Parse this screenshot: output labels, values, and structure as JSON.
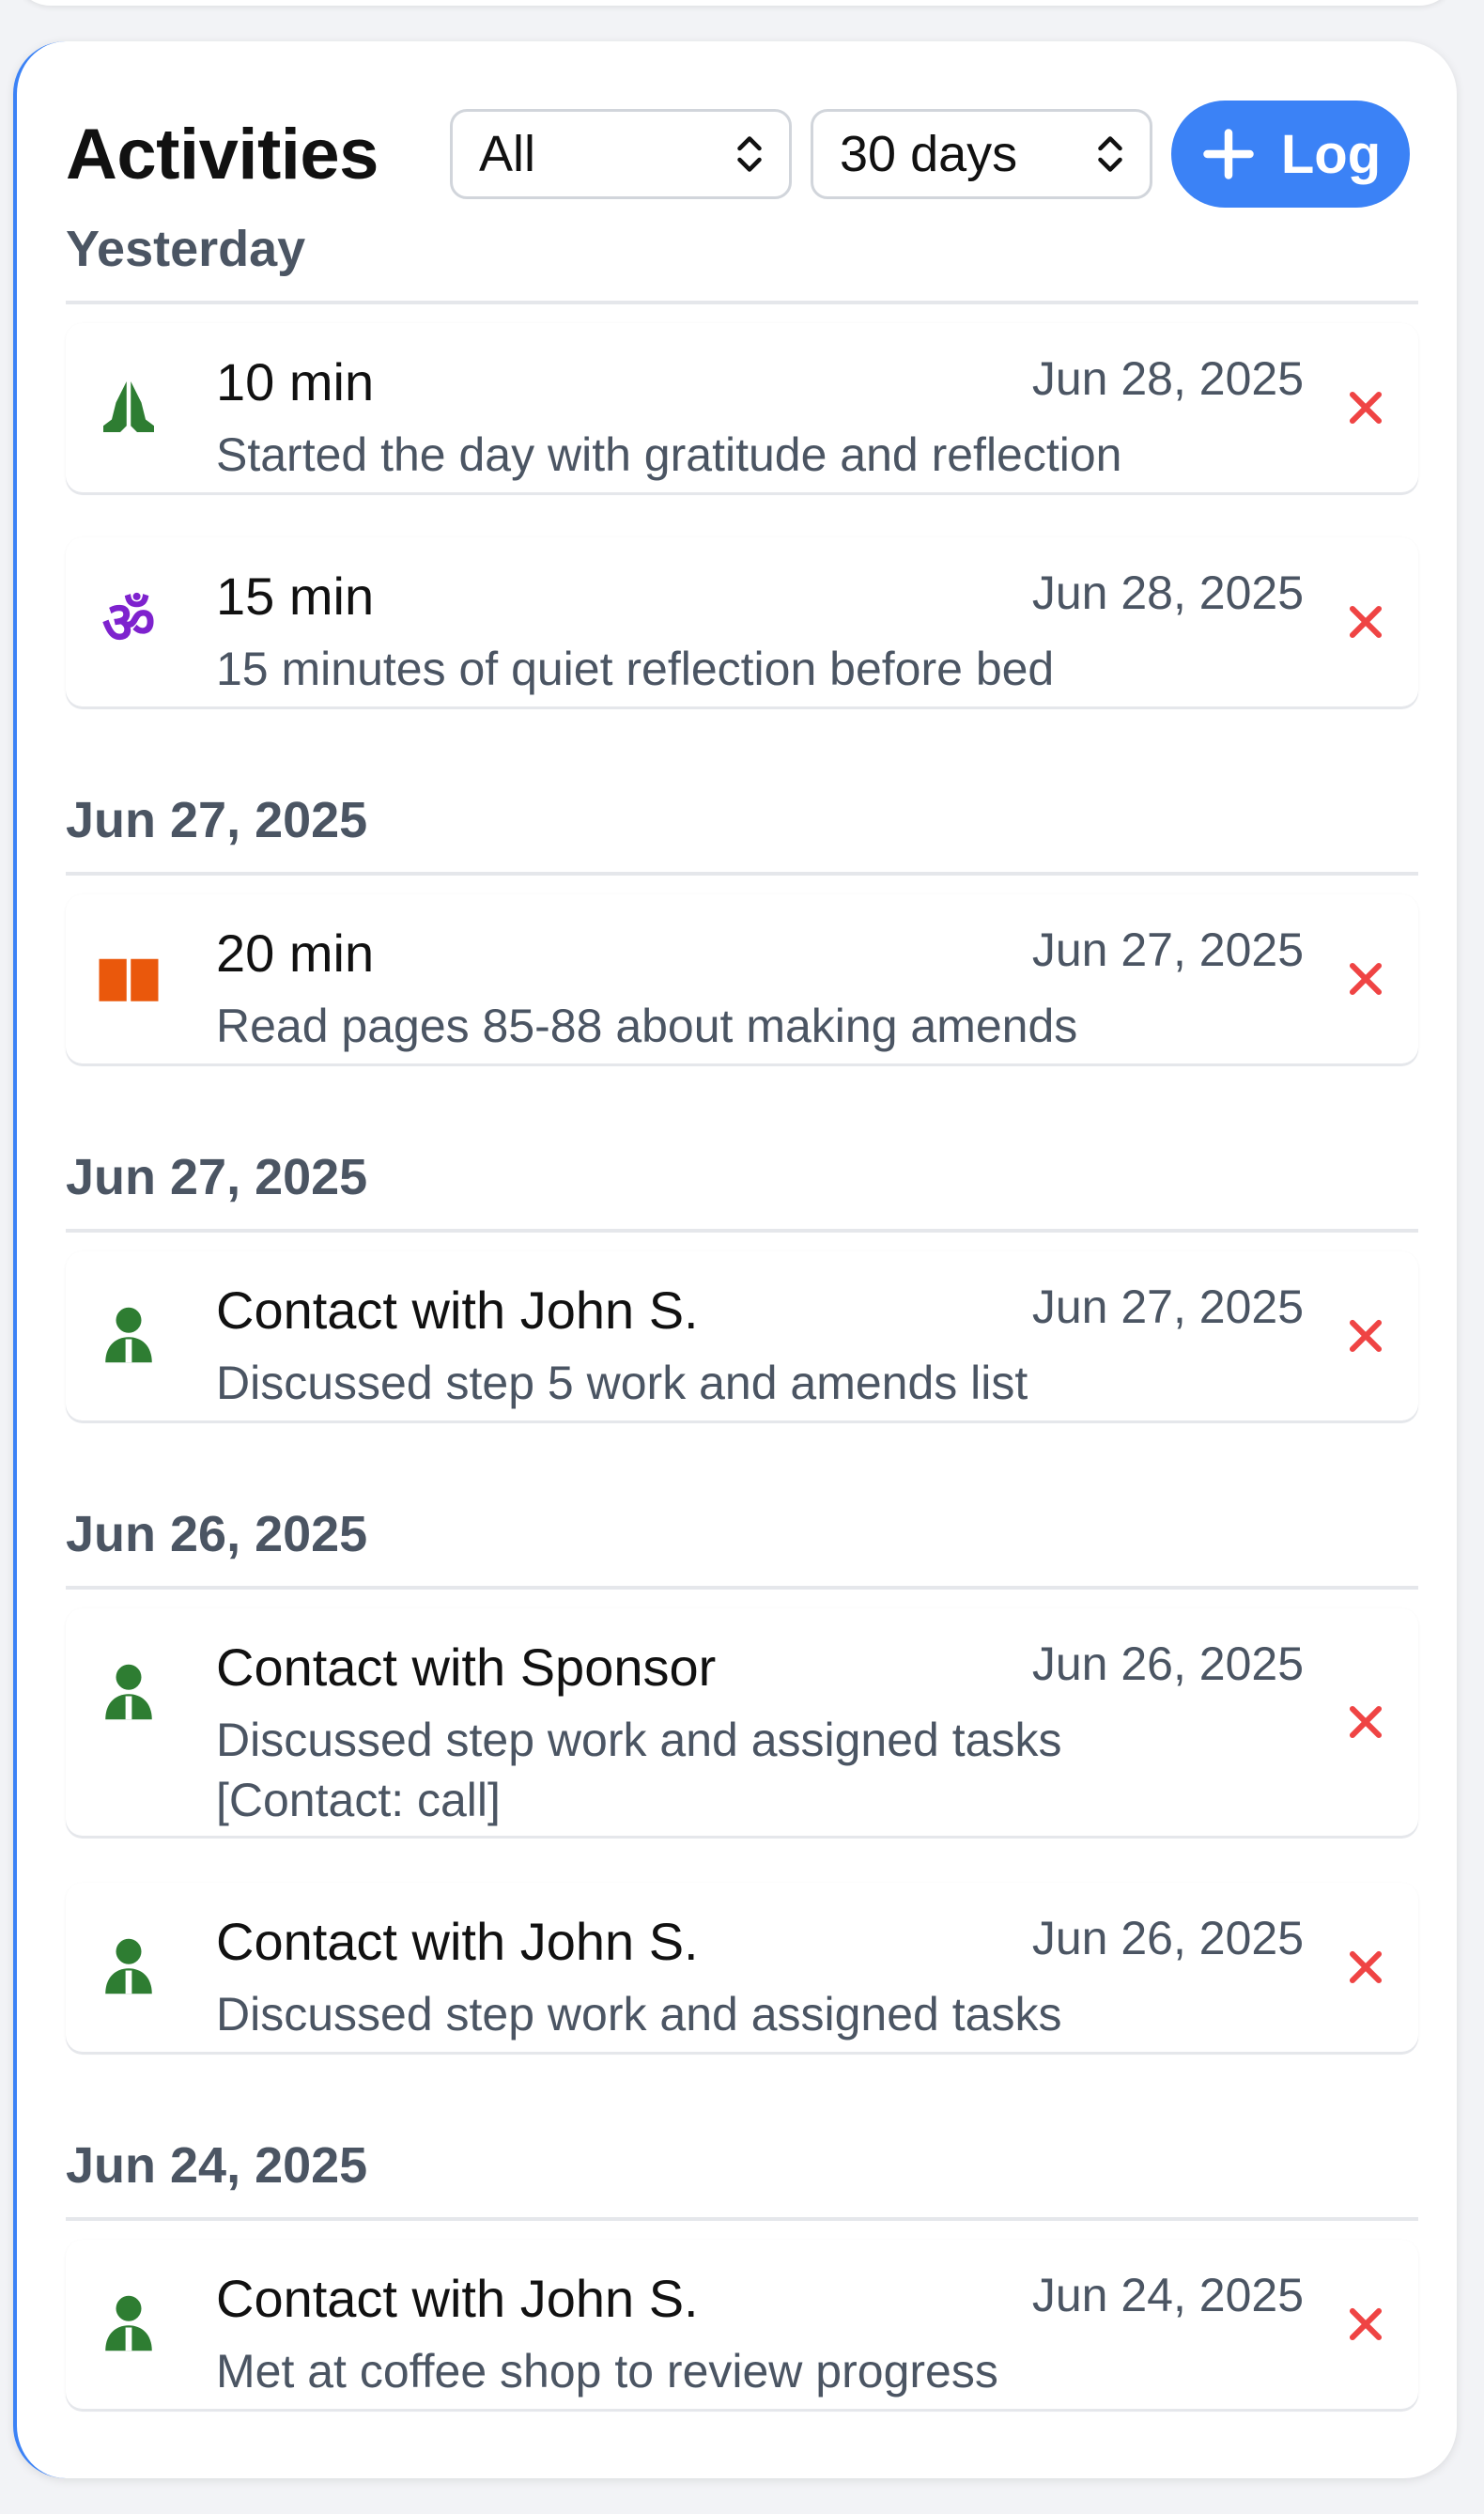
{
  "header": {
    "title": "Activities",
    "filter_value": "All",
    "range_value": "30 days",
    "log_label": "Log"
  },
  "groups": [
    {
      "label": "Yesterday",
      "items": [
        {
          "icon": "praying-hands-icon",
          "title": "10 min",
          "date": "Jun 28, 2025",
          "desc": "Started the day with gratitude and reflection"
        },
        {
          "icon": "om-icon",
          "title": "15 min",
          "date": "Jun 28, 2025",
          "desc": "15 minutes of quiet reflection before bed"
        }
      ]
    },
    {
      "label": "Jun 27, 2025",
      "items": [
        {
          "icon": "book-icon",
          "title": "20 min",
          "date": "Jun 27, 2025",
          "desc": "Read pages 85-88 about making amends"
        }
      ]
    },
    {
      "label": "Jun 27, 2025",
      "items": [
        {
          "icon": "person-icon",
          "title": "Contact with John S.",
          "date": "Jun 27, 2025",
          "desc": "Discussed step 5 work and amends list"
        }
      ]
    },
    {
      "label": "Jun 26, 2025",
      "items": [
        {
          "icon": "person-icon",
          "title": "Contact with Sponsor",
          "date": "Jun 26, 2025",
          "desc": "Discussed step work and assigned tasks",
          "desc2": "[Contact: call]"
        },
        {
          "icon": "person-icon",
          "title": "Contact with John S.",
          "date": "Jun 26, 2025",
          "desc": "Discussed step work and assigned tasks"
        }
      ]
    },
    {
      "label": "Jun 24, 2025",
      "items": [
        {
          "icon": "person-icon",
          "title": "Contact with John S.",
          "date": "Jun 24, 2025",
          "desc": "Met at coffee shop to review progress"
        }
      ]
    }
  ],
  "colors": {
    "accent": "#3b82f6",
    "delete": "#ef4444",
    "praying-hands": "#2e7d32",
    "om": "#7e22ce",
    "book": "#ea580c",
    "person": "#2e7d32"
  }
}
